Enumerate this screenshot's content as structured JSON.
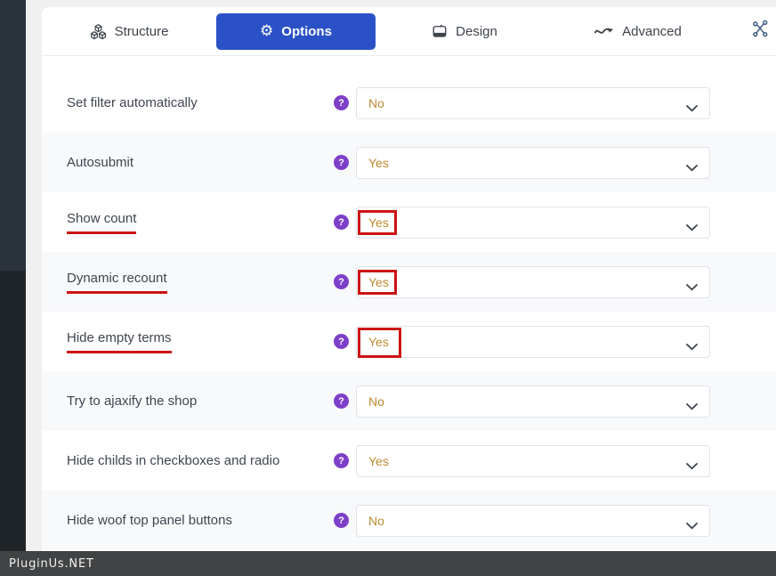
{
  "tabs": [
    {
      "label": "Structure",
      "icon": "cubes-icon",
      "active": false
    },
    {
      "label": "Options",
      "icon": "gear-icon",
      "active": true
    },
    {
      "label": "Design",
      "icon": "image-icon",
      "active": false
    },
    {
      "label": "Advanced",
      "icon": "wave-icon",
      "active": false
    },
    {
      "label": "",
      "icon": "network-icon",
      "active": false
    }
  ],
  "rows": [
    {
      "label": "Set filter automatically",
      "value": "No",
      "underlined": false,
      "boxed": ""
    },
    {
      "label": "Autosubmit",
      "value": "Yes",
      "underlined": false,
      "boxed": ""
    },
    {
      "label": "Show count",
      "value": "Yes",
      "underlined": true,
      "boxed": "small"
    },
    {
      "label": "Dynamic recount",
      "value": "Yes",
      "underlined": true,
      "boxed": "small"
    },
    {
      "label": "Hide empty terms",
      "value": "Yes",
      "underlined": true,
      "boxed": "tall"
    },
    {
      "label": "Try to ajaxify the shop",
      "value": "No",
      "underlined": false,
      "boxed": ""
    },
    {
      "label": "Hide childs in checkboxes and radio",
      "value": "Yes",
      "underlined": false,
      "boxed": ""
    },
    {
      "label": "Hide woof top panel buttons",
      "value": "No",
      "underlined": false,
      "boxed": ""
    }
  ],
  "icons": {
    "help_glyph": "?",
    "gear_glyph": "⚙"
  },
  "watermark": "PluginUs.NET",
  "colors": {
    "accent": "#2b51c6",
    "purple": "#7d3fc8",
    "red": "#cc1414",
    "value": "#bd8a2e",
    "row_alt": "#f8f9fb",
    "sidebar_top": "#2b333c",
    "sidebar_bottom": "#20252a"
  }
}
